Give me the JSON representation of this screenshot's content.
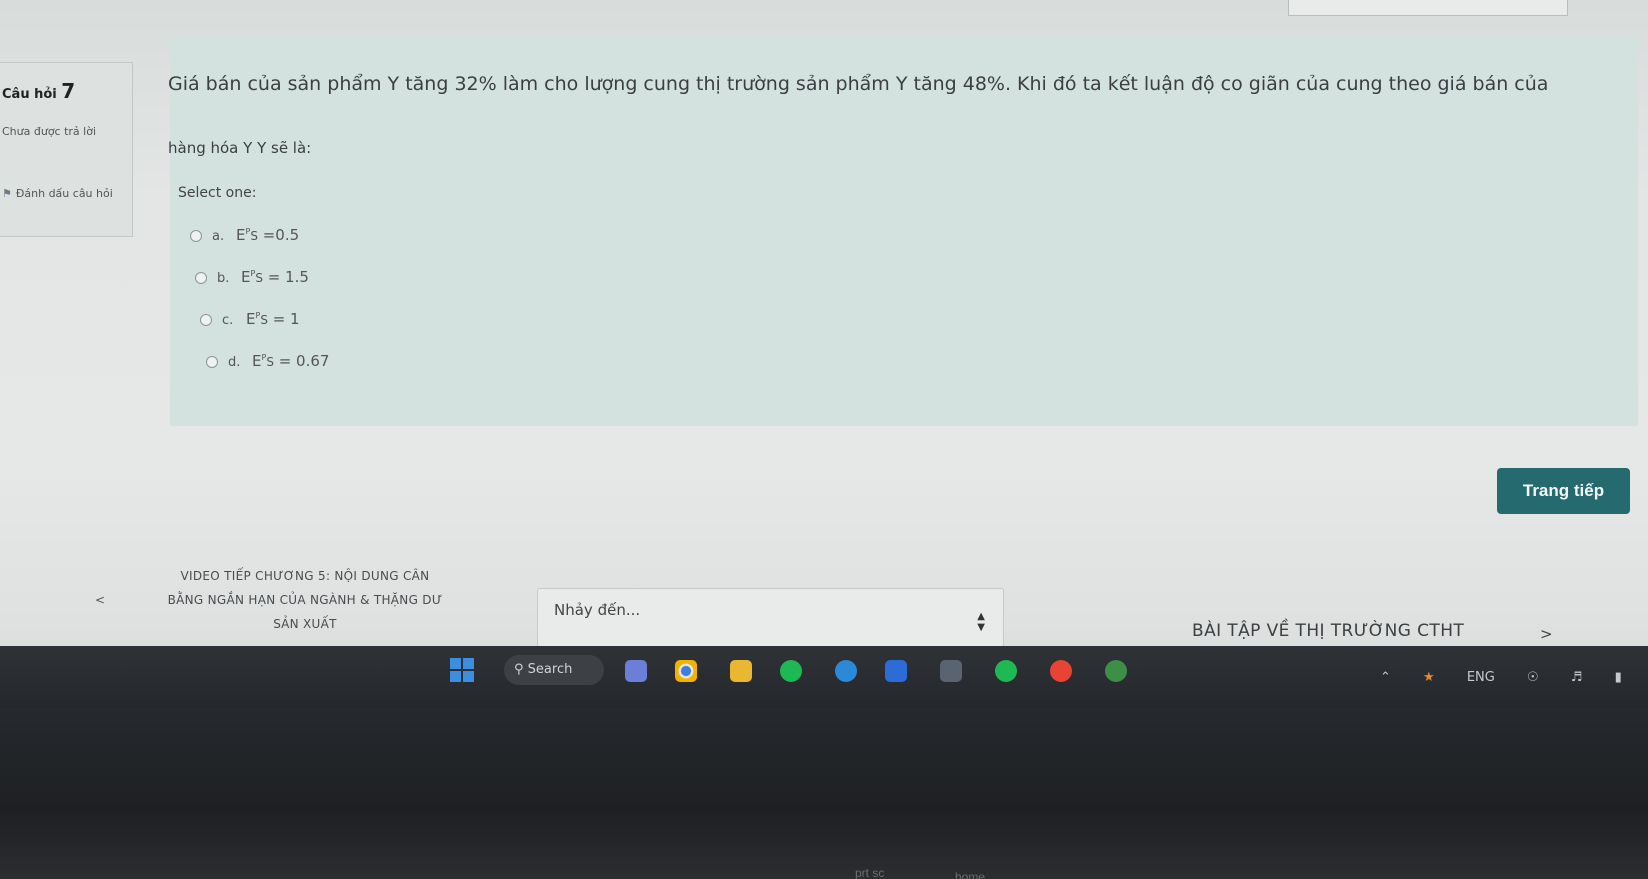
{
  "question": {
    "number_label": "Câu hỏi",
    "number": "7",
    "state": "Chưa được trả lời",
    "flag_label": "Đánh dấu câu hỏi",
    "text_line1": "Giá bán của sản phẩm Y tăng 32% làm cho lượng cung thị trường sản phẩm Y tăng 48%. Khi đó ta kết luận độ co giãn của cung theo giá bán của",
    "text_line2": "hàng hóa Y Y sẽ là:",
    "select_prompt": "Select one:",
    "options": [
      {
        "letter": "a.",
        "formula": "E",
        "sup": "P",
        "sub": "S",
        "value": "=0.5"
      },
      {
        "letter": "b.",
        "formula": "E",
        "sup": "P",
        "sub": "S",
        "value": "= 1.5"
      },
      {
        "letter": "c.",
        "formula": "E",
        "sup": "P",
        "sub": "S",
        "value": "= 1"
      },
      {
        "letter": "d.",
        "formula": "E",
        "sup": "P",
        "sub": "S",
        "value": "= 0.67"
      }
    ]
  },
  "nav": {
    "next_page_button": "Trang tiếp",
    "prev_arrow": "<",
    "prev_link_lines": [
      "VIDEO TIẾP CHƯƠNG 5: NỘI DUNG CÂN",
      "BẰNG NGẮN HẠN CỦA NGÀNH & THẶNG DƯ",
      "SẢN XUẤT"
    ],
    "jump_placeholder": "Nhảy đến...",
    "next_link": "BÀI TẬP VỀ THỊ TRƯỜNG CTHT",
    "next_arrow": ">"
  },
  "taskbar": {
    "search_label": "Search",
    "language": "ENG",
    "icons": [
      "windows-icon",
      "search-icon",
      "copilot-icon",
      "chrome-icon",
      "file-explorer-icon",
      "spotify-icon",
      "edge-icon",
      "zalo-icon",
      "store-icon",
      "spotify-icon",
      "chrome-icon",
      "chrome-icon"
    ]
  },
  "keyboard": {
    "keys": [
      "prt sc",
      "home"
    ]
  },
  "colors": {
    "accent": "#256a6e",
    "panel": "#d3e2de",
    "taskbar": "#2f3236"
  }
}
